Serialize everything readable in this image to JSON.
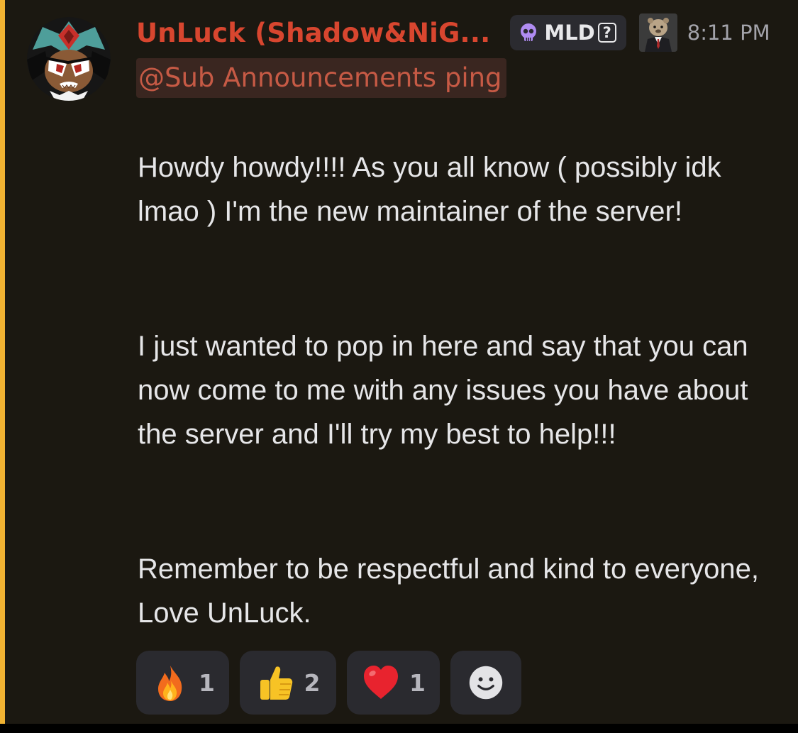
{
  "message": {
    "author": "UnLuck (Shadow&NiG...",
    "role_tag": {
      "icon": "skull-icon",
      "label": "MLD",
      "help": "?"
    },
    "timestamp": "8:11 PM",
    "mention": "@Sub Announcements ping",
    "paragraphs": [
      "Howdy howdy!!!! As you all know ( possibly idk lmao ) I'm the new maintainer of the server!",
      "I just wanted to pop in here and say that you can now come to me with any issues you have about the server and I'll try my best to help!!!",
      "Remember to be respectful and kind to everyone, Love UnLuck."
    ]
  },
  "reactions": [
    {
      "icon": "fire-emoji",
      "count": "1"
    },
    {
      "icon": "thumbs-up-emoji",
      "count": "2"
    },
    {
      "icon": "heart-emoji",
      "count": "1"
    },
    {
      "icon": "add-reaction-smiley-icon",
      "count": ""
    }
  ],
  "colors": {
    "background": "#1b1811",
    "highlight_bar": "#f0b232",
    "username": "#d8462f",
    "mention_text": "#c65a45",
    "mention_background": "#3a2620",
    "body_text": "#e6e6e8",
    "timestamp": "#a3a3aa",
    "chip_background": "#2a2a2f"
  }
}
